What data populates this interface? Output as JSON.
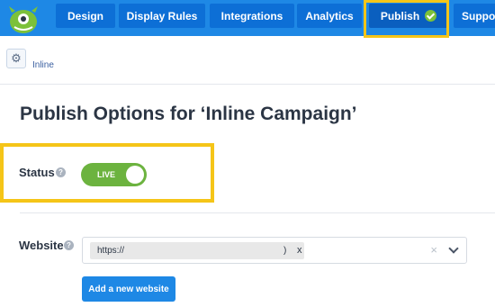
{
  "nav": {
    "items": [
      {
        "label": "Design"
      },
      {
        "label": "Display Rules"
      },
      {
        "label": "Integrations"
      },
      {
        "label": "Analytics"
      },
      {
        "label": "Publish"
      },
      {
        "label": "Suppor"
      }
    ]
  },
  "breadcrumb": {
    "current": "Inline"
  },
  "page": {
    "title": "Publish Options for ‘Inline Campaign’"
  },
  "status": {
    "label": "Status",
    "toggle_text": "LIVE",
    "live": true
  },
  "website": {
    "label": "Website",
    "selected_tag": "https://",
    "selected_tag_suffix": ")",
    "tag_remove": "x",
    "clear": "×",
    "add_button": "Add a new website"
  },
  "icons": {
    "help": "?",
    "settings": "⚙"
  },
  "colors": {
    "nav_bg": "#1e88e5",
    "highlight": "#f5c518",
    "live_green": "#6cb33f",
    "button_blue": "#1e88e5"
  }
}
